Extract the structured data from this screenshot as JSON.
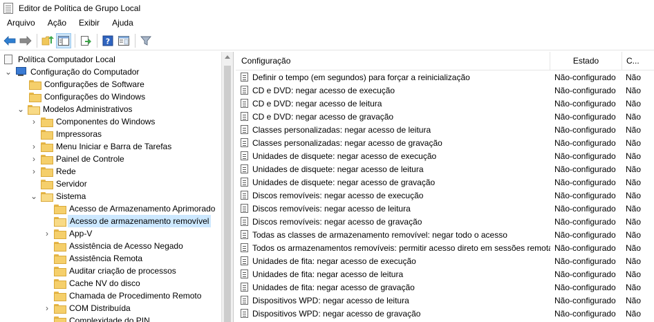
{
  "window": {
    "title": "Editor de Política de Grupo Local"
  },
  "menu": [
    "Arquivo",
    "Ação",
    "Exibir",
    "Ajuda"
  ],
  "toolbar": {
    "buttons": [
      "back-arrow-icon",
      "forward-arrow-icon",
      "up-folder-icon",
      "show-hide-tree-icon",
      "export-list-icon",
      "help-icon",
      "properties-view-icon",
      "filter-icon"
    ]
  },
  "tree": {
    "root": "Política Computador Local",
    "computer_config": "Configuração do Computador",
    "software_settings": "Configurações de Software",
    "windows_settings": "Configurações do Windows",
    "admin_templates": "Modelos Administrativos",
    "windows_components": "Componentes do Windows",
    "printers": "Impressoras",
    "start_menu": "Menu Iniciar e Barra de Tarefas",
    "control_panel": "Painel de Controle",
    "network": "Rede",
    "server": "Servidor",
    "system": "Sistema",
    "enhanced_storage": "Acesso de Armazenamento Aprimorado",
    "removable_storage": "Acesso de armazenamento removível",
    "app_v": "App-V",
    "access_denied": "Assistência de Acesso Negado",
    "remote_assistance": "Assistência Remota",
    "process_creation": "Auditar criação de processos",
    "disk_nv_cache": "Cache NV do disco",
    "rpc": "Chamada de Procedimento Remoto",
    "distributed_com": "COM Distribuída",
    "pin_complexity": "Complexidade do PIN"
  },
  "list": {
    "headers": {
      "setting": "Configuração",
      "state": "Estado",
      "comment": "C..."
    },
    "rows": [
      {
        "setting": "Definir o tempo (em segundos) para forçar a reinicialização",
        "state": "Não-configurado",
        "comment": "Não"
      },
      {
        "setting": "CD e DVD: negar acesso de execução",
        "state": "Não-configurado",
        "comment": "Não"
      },
      {
        "setting": "CD e DVD: negar acesso de leitura",
        "state": "Não-configurado",
        "comment": "Não"
      },
      {
        "setting": "CD e DVD: negar acesso de gravação",
        "state": "Não-configurado",
        "comment": "Não"
      },
      {
        "setting": "Classes personalizadas: negar acesso de leitura",
        "state": "Não-configurado",
        "comment": "Não"
      },
      {
        "setting": "Classes personalizadas: negar acesso de gravação",
        "state": "Não-configurado",
        "comment": "Não"
      },
      {
        "setting": "Unidades de disquete: negar acesso de execução",
        "state": "Não-configurado",
        "comment": "Não"
      },
      {
        "setting": "Unidades de disquete: negar acesso de leitura",
        "state": "Não-configurado",
        "comment": "Não"
      },
      {
        "setting": "Unidades de disquete: negar acesso de gravação",
        "state": "Não-configurado",
        "comment": "Não"
      },
      {
        "setting": "Discos removíveis: negar acesso de execução",
        "state": "Não-configurado",
        "comment": "Não"
      },
      {
        "setting": "Discos removíveis: negar acesso de leitura",
        "state": "Não-configurado",
        "comment": "Não"
      },
      {
        "setting": "Discos removíveis: negar acesso de gravação",
        "state": "Não-configurado",
        "comment": "Não"
      },
      {
        "setting": "Todas as classes de armazenamento removível: negar todo o acesso",
        "state": "Não-configurado",
        "comment": "Não"
      },
      {
        "setting": "Todos os armazenamentos removíveis: permitir acesso direto em sessões remotas",
        "state": "Não-configurado",
        "comment": "Não"
      },
      {
        "setting": "Unidades de fita: negar acesso de execução",
        "state": "Não-configurado",
        "comment": "Não"
      },
      {
        "setting": "Unidades de fita: negar acesso de leitura",
        "state": "Não-configurado",
        "comment": "Não"
      },
      {
        "setting": "Unidades de fita: negar acesso de gravação",
        "state": "Não-configurado",
        "comment": "Não"
      },
      {
        "setting": "Dispositivos WPD: negar acesso de leitura",
        "state": "Não-configurado",
        "comment": "Não"
      },
      {
        "setting": "Dispositivos WPD: negar acesso de gravação",
        "state": "Não-configurado",
        "comment": "Não"
      }
    ]
  }
}
